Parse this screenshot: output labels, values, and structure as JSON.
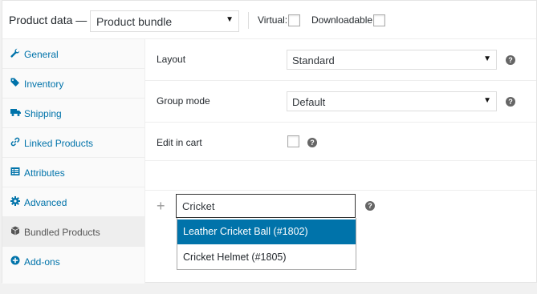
{
  "header": {
    "title": "Product data —",
    "product_type": "Product bundle",
    "virtual_label": "Virtual:",
    "downloadable_label": "Downloadable:",
    "virtual_checked": false,
    "downloadable_checked": false
  },
  "tabs": [
    {
      "label": "General",
      "icon": "wrench-icon"
    },
    {
      "label": "Inventory",
      "icon": "tag-icon"
    },
    {
      "label": "Shipping",
      "icon": "truck-icon"
    },
    {
      "label": "Linked Products",
      "icon": "link-icon"
    },
    {
      "label": "Attributes",
      "icon": "list-icon"
    },
    {
      "label": "Advanced",
      "icon": "gear-icon"
    },
    {
      "label": "Bundled Products",
      "icon": "cube-icon",
      "active": true
    },
    {
      "label": "Add-ons",
      "icon": "plus-circle-icon"
    }
  ],
  "fields": {
    "layout": {
      "label": "Layout",
      "value": "Standard"
    },
    "group_mode": {
      "label": "Group mode",
      "value": "Default"
    },
    "edit_in_cart": {
      "label": "Edit in cart",
      "checked": false
    }
  },
  "search": {
    "value": "Cricket",
    "results": [
      "Leather Cricket Ball (#1802)",
      "Cricket Helmet (#1805)"
    ]
  },
  "colors": {
    "accent": "#0073aa",
    "active_tab": "#eeeeee"
  }
}
